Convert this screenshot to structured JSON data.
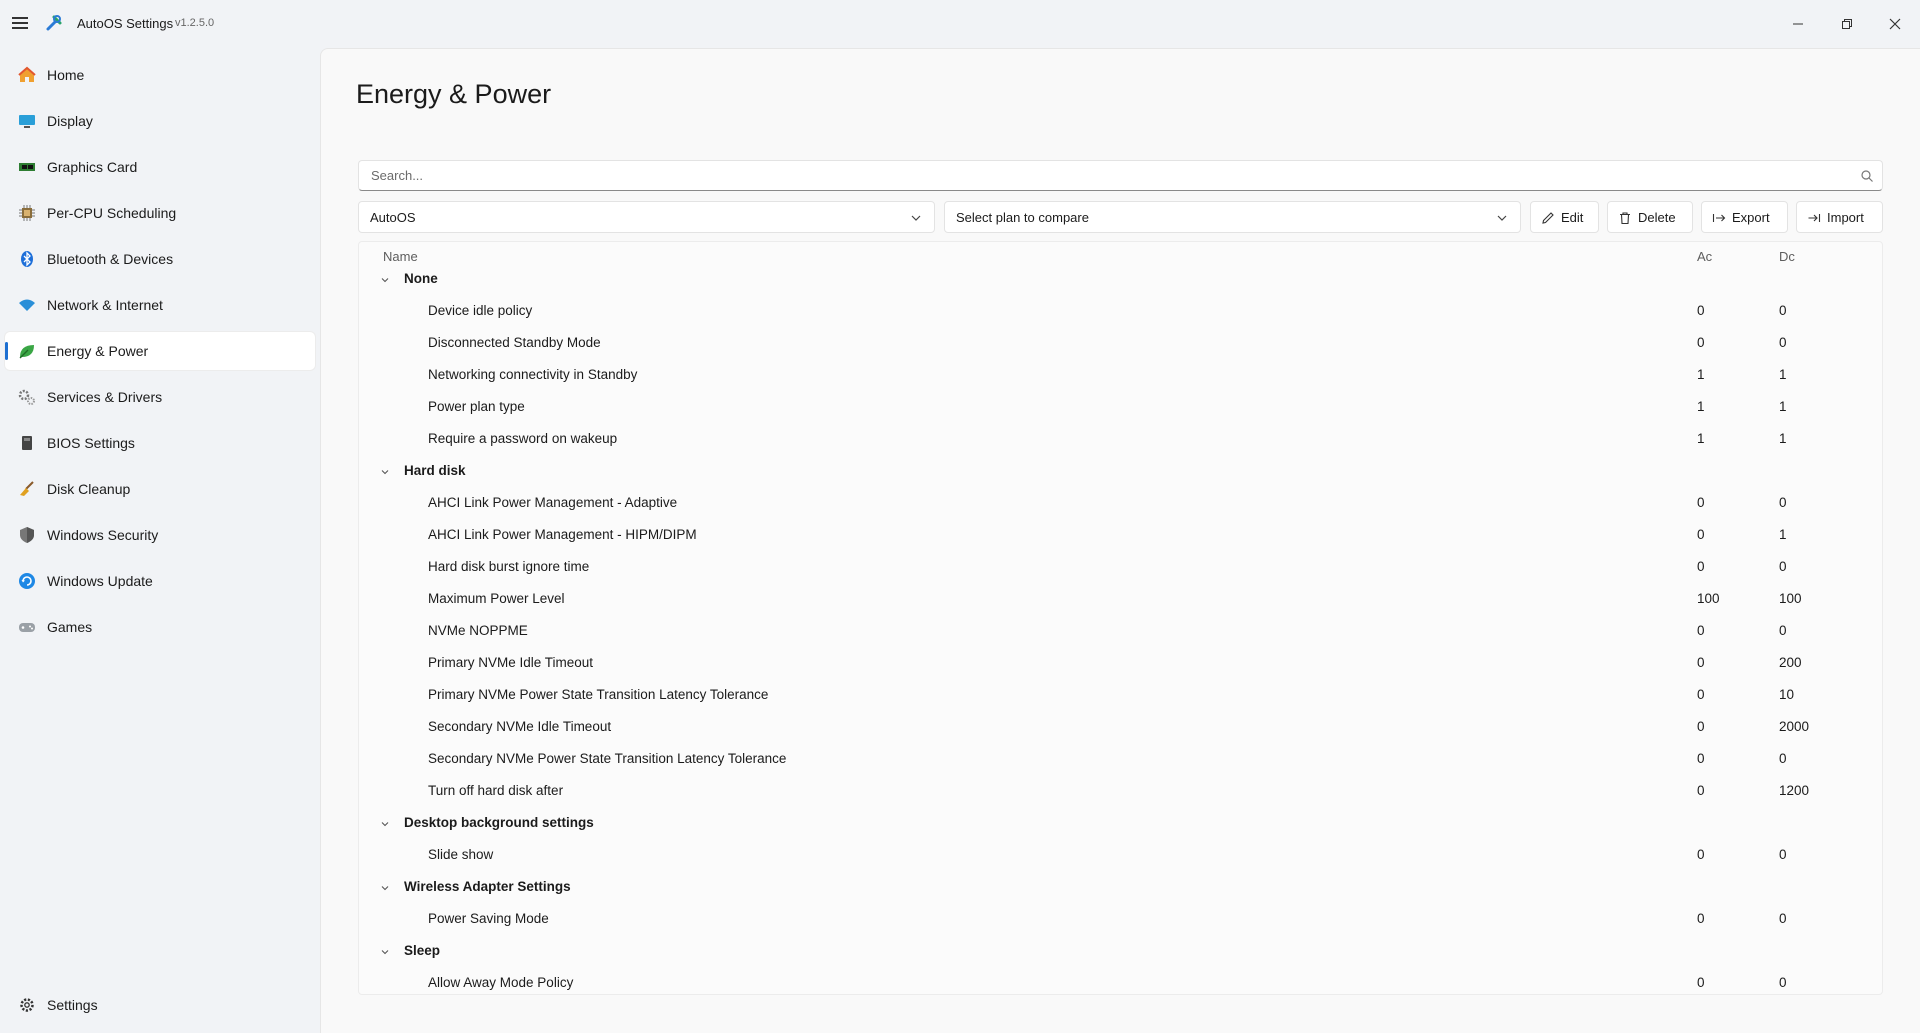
{
  "app": {
    "title": "AutoOS Settings",
    "version": "v1.2.5.0"
  },
  "sidebar": {
    "items": [
      {
        "label": "Home",
        "icon": "home-icon"
      },
      {
        "label": "Display",
        "icon": "display-icon"
      },
      {
        "label": "Graphics Card",
        "icon": "graphics-card-icon"
      },
      {
        "label": "Per-CPU Scheduling",
        "icon": "cpu-icon"
      },
      {
        "label": "Bluetooth & Devices",
        "icon": "bluetooth-icon"
      },
      {
        "label": "Network & Internet",
        "icon": "wifi-icon"
      },
      {
        "label": "Energy & Power",
        "icon": "leaf-icon",
        "active": true
      },
      {
        "label": "Services & Drivers",
        "icon": "gears-icon"
      },
      {
        "label": "BIOS Settings",
        "icon": "bios-chip-icon"
      },
      {
        "label": "Disk Cleanup",
        "icon": "broom-icon"
      },
      {
        "label": "Windows Security",
        "icon": "shield-icon"
      },
      {
        "label": "Windows Update",
        "icon": "update-icon"
      },
      {
        "label": "Games",
        "icon": "gamepad-icon"
      }
    ],
    "settings_label": "Settings"
  },
  "page": {
    "title": "Energy & Power"
  },
  "search": {
    "placeholder": "Search..."
  },
  "toolbar": {
    "plan_selected": "AutoOS",
    "compare_placeholder": "Select plan to compare",
    "edit": "Edit",
    "delete": "Delete",
    "export": "Export",
    "import": "Import"
  },
  "table": {
    "columns": {
      "name": "Name",
      "ac": "Ac",
      "dc": "Dc"
    },
    "groups": [
      {
        "name": "None",
        "rows": [
          {
            "name": "Device idle policy",
            "ac": "0",
            "dc": "0"
          },
          {
            "name": "Disconnected Standby Mode",
            "ac": "0",
            "dc": "0"
          },
          {
            "name": "Networking connectivity in Standby",
            "ac": "1",
            "dc": "1"
          },
          {
            "name": "Power plan type",
            "ac": "1",
            "dc": "1"
          },
          {
            "name": "Require a password on wakeup",
            "ac": "1",
            "dc": "1"
          }
        ]
      },
      {
        "name": "Hard disk",
        "rows": [
          {
            "name": "AHCI Link Power Management - Adaptive",
            "ac": "0",
            "dc": "0"
          },
          {
            "name": "AHCI Link Power Management - HIPM/DIPM",
            "ac": "0",
            "dc": "1"
          },
          {
            "name": "Hard disk burst ignore time",
            "ac": "0",
            "dc": "0"
          },
          {
            "name": "Maximum Power Level",
            "ac": "100",
            "dc": "100"
          },
          {
            "name": "NVMe NOPPME",
            "ac": "0",
            "dc": "0"
          },
          {
            "name": "Primary NVMe Idle Timeout",
            "ac": "0",
            "dc": "200"
          },
          {
            "name": "Primary NVMe Power State Transition Latency Tolerance",
            "ac": "0",
            "dc": "10"
          },
          {
            "name": "Secondary NVMe Idle Timeout",
            "ac": "0",
            "dc": "2000"
          },
          {
            "name": "Secondary NVMe Power State Transition Latency Tolerance",
            "ac": "0",
            "dc": "0"
          },
          {
            "name": "Turn off hard disk after",
            "ac": "0",
            "dc": "1200"
          }
        ]
      },
      {
        "name": "Desktop background settings",
        "rows": [
          {
            "name": "Slide show",
            "ac": "0",
            "dc": "0"
          }
        ]
      },
      {
        "name": "Wireless Adapter Settings",
        "rows": [
          {
            "name": "Power Saving Mode",
            "ac": "0",
            "dc": "0"
          }
        ]
      },
      {
        "name": "Sleep",
        "rows": [
          {
            "name": "Allow Away Mode Policy",
            "ac": "0",
            "dc": "0"
          }
        ]
      }
    ]
  },
  "colors": {
    "accent": "#1d6fd1",
    "sidebar_bg": "#f1f3f6",
    "content_bg": "#f9f9f9"
  }
}
